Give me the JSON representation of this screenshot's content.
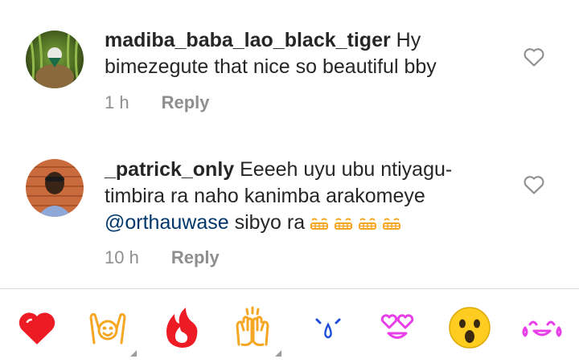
{
  "comments": [
    {
      "username": "madiba_baba_lao_black_tiger",
      "text": " Hy bimezegute  that  nice  so beautiful bby",
      "time": "1 h",
      "reply_label": "Reply"
    },
    {
      "username": "_patrick_only",
      "text": " Eeeeh uyu ubu ntiyagu- timbira ra naho kanimba arakomeye ",
      "mention": "@orthauwase",
      "after_mention": " sibyo ra",
      "time": "10 h",
      "reply_label": "Reply"
    }
  ],
  "reactions": [
    "red-heart",
    "raising-hands",
    "fire",
    "clapping-hands",
    "crying-face",
    "heart-eyes-face",
    "astonished-face",
    "tears-of-joy-face"
  ],
  "colors": {
    "mention": "#00376b",
    "meta": "#8e8e8e",
    "heart": "#ed1c24",
    "emoji_orange": "#f5a623",
    "emoji_blue": "#1f4fd6",
    "emoji_pink": "#e83ee8"
  }
}
